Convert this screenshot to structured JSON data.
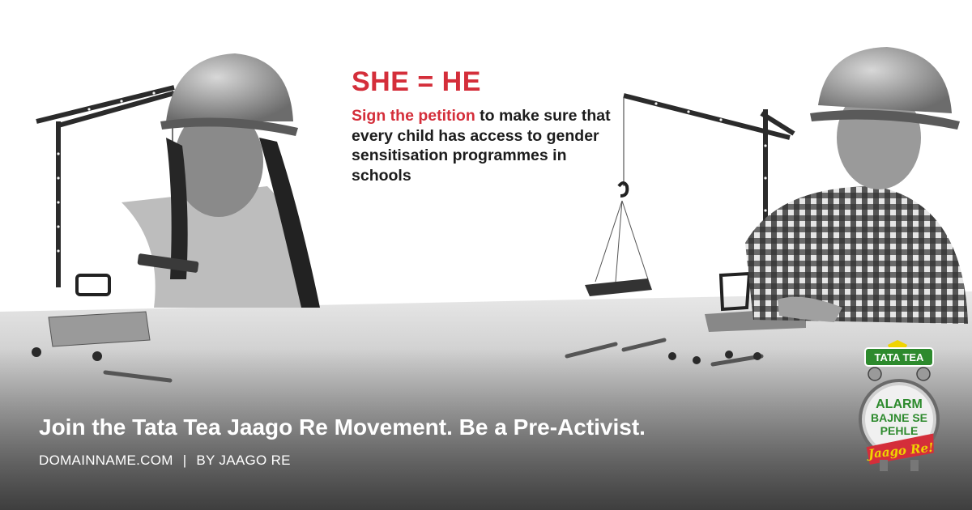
{
  "campaign": {
    "headline": "SHE = HE",
    "petition_link": "Sign the petition",
    "body_rest": " to make sure that every child has access to gender sensitisation programmes in schools"
  },
  "video": {
    "play_icon": "play-icon"
  },
  "footer": {
    "tagline": "Join the Tata Tea Jaago Re Movement. Be a Pre-Activist.",
    "domain": "DOMAINNAME.COM",
    "separator": "|",
    "byline": "BY JAAGO RE"
  },
  "logo": {
    "brand": "TATA TEA",
    "line1": "ALARM",
    "line2": "BAJNE SE",
    "line3": "PEHLE",
    "line4": "Jaago Re!"
  },
  "colors": {
    "accent": "#d42e3a",
    "brand_green": "#2d8a2d",
    "brand_yellow": "#f0d400"
  }
}
